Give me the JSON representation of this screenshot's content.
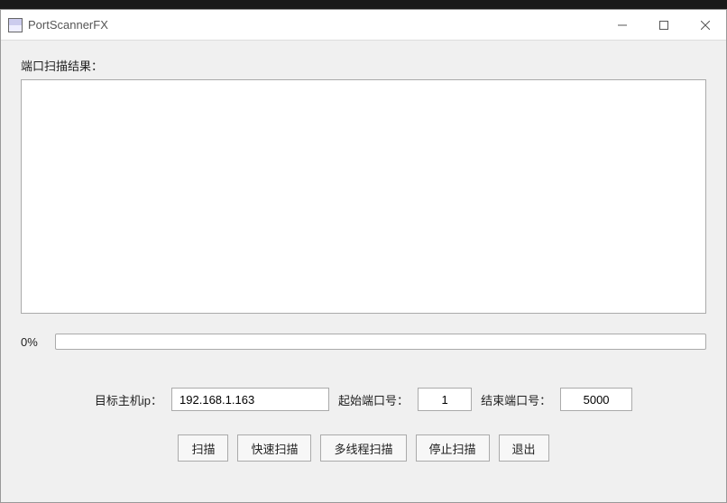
{
  "window": {
    "title": "PortScannerFX"
  },
  "labels": {
    "result_label": "端口扫描结果：",
    "progress_text": "0%",
    "target_ip_label": "目标主机ip：",
    "start_port_label": "起始端口号：",
    "end_port_label": "结束端口号："
  },
  "inputs": {
    "target_ip": "192.168.1.163",
    "start_port": "1",
    "end_port": "5000",
    "result_text": ""
  },
  "buttons": {
    "scan": "扫描",
    "fast_scan": "快速扫描",
    "multi_thread_scan": "多线程扫描",
    "stop_scan": "停止扫描",
    "exit": "退出"
  },
  "progress_percent": 0
}
